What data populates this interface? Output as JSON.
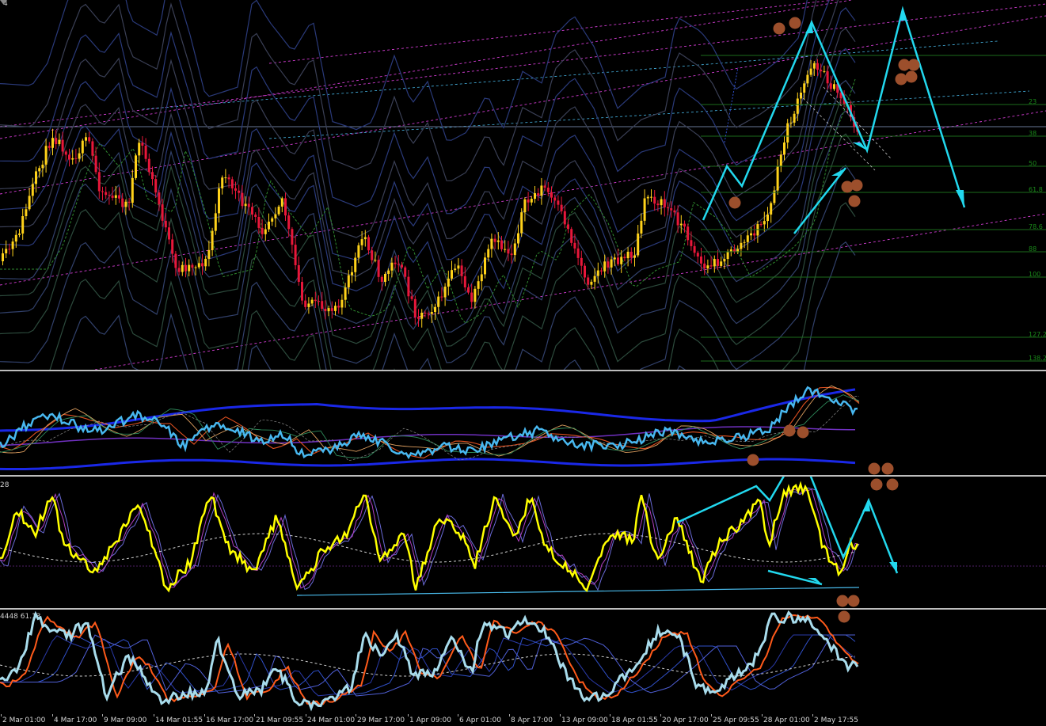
{
  "window": {
    "title_fragment": "4"
  },
  "main_pane": {
    "fib_levels": [
      {
        "label": "23"
      },
      {
        "label": "38"
      },
      {
        "label": "50"
      },
      {
        "label": "61.8"
      },
      {
        "label": "78.6"
      },
      {
        "label": "88"
      },
      {
        "label": "100"
      },
      {
        "label": "127.2"
      },
      {
        "label": "138.2"
      }
    ]
  },
  "indicator_pane_2": {
    "label": "28"
  },
  "indicator_pane_3": {
    "label": "4448 61.13"
  },
  "time_axis": {
    "labels": [
      "2 Mar 01:00",
      "4 Mar 17:00",
      "9 Mar 09:00",
      "14 Mar 01:55",
      "16 Mar 17:00",
      "21 Mar 09:55",
      "24 Mar 01:00",
      "29 Mar 17:00",
      "1 Apr 09:00",
      "6 Apr 01:00",
      "8 Apr 17:00",
      "13 Apr 09:00",
      "18 Apr 01:55",
      "20 Apr 17:00",
      "25 Apr 09:55",
      "28 Apr 01:00",
      "2 May 17:55"
    ]
  },
  "colors": {
    "background": "#000000",
    "bull_candle": "#ffd21a",
    "bear_candle": "#e8173a",
    "annotation": "#22d8ee",
    "marker": "#9c4f2c",
    "fib": "#1c6b1c",
    "channel": "#d23cd2",
    "separator": "#bdbdbd"
  }
}
